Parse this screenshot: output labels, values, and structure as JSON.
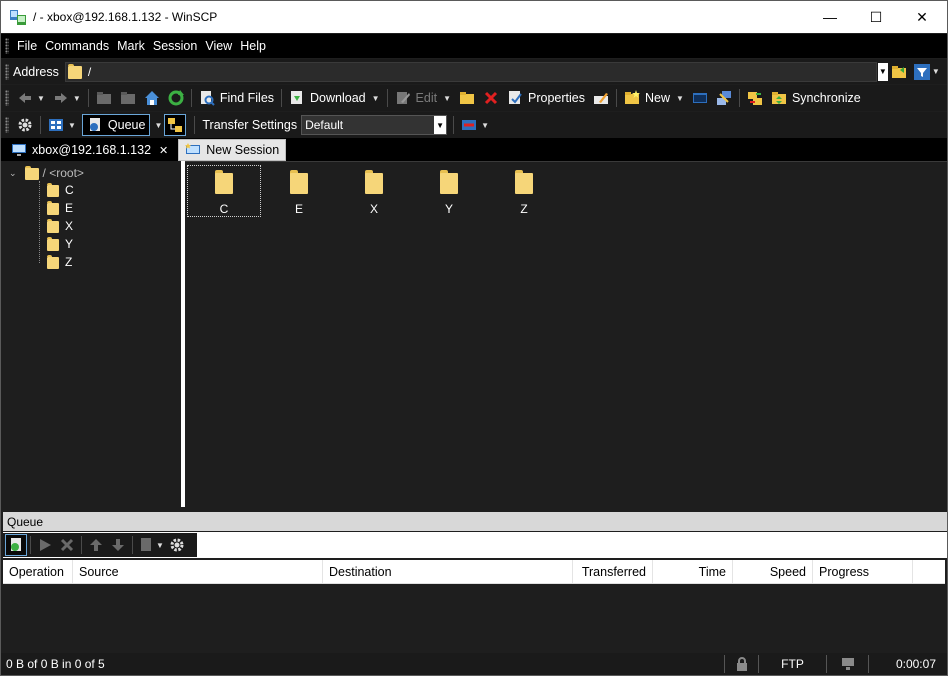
{
  "window": {
    "title": "/ - xbox@192.168.1.132 - WinSCP",
    "minimize_glyph": "—",
    "maximize_glyph": "☐",
    "close_glyph": "✕"
  },
  "menu": [
    "File",
    "Commands",
    "Mark",
    "Session",
    "View",
    "Help"
  ],
  "address": {
    "label": "Address",
    "path": "/"
  },
  "toolbar1": {
    "find_files": "Find Files",
    "download": "Download",
    "edit": "Edit",
    "properties": "Properties",
    "new": "New",
    "synchronize": "Synchronize"
  },
  "toolbar2": {
    "queue": "Queue",
    "transfer_settings_label": "Transfer Settings",
    "transfer_settings_value": "Default"
  },
  "tabs": {
    "session": "xbox@192.168.1.132",
    "close_glyph": "✕",
    "new_session": "New Session"
  },
  "tree": {
    "root_label": "/ <root>",
    "children": [
      "C",
      "E",
      "X",
      "Y",
      "Z"
    ]
  },
  "files": [
    "C",
    "E",
    "X",
    "Y",
    "Z"
  ],
  "queue": {
    "header": "Queue",
    "columns": [
      "Operation",
      "Source",
      "Destination",
      "Transferred",
      "Time",
      "Speed",
      "Progress"
    ]
  },
  "status": {
    "transfer": "0 B of 0 B in 0 of 5",
    "protocol": "FTP",
    "elapsed": "0:00:07"
  },
  "colors": {
    "folder": "#f6d679",
    "folder_tab": "#e8c050",
    "background": "#1e1e1e",
    "queue_header": "#d8d8d8"
  }
}
